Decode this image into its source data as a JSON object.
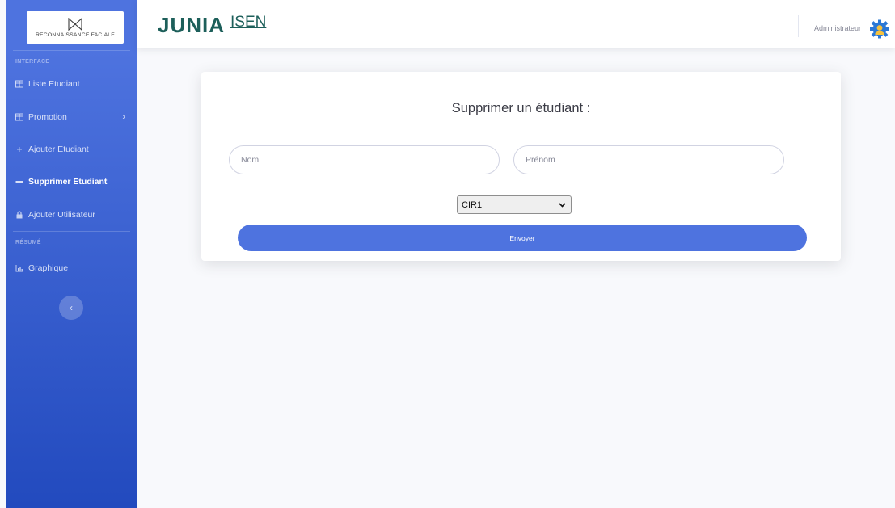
{
  "sidebar": {
    "logo_text": "RECONNAISSANCE FACIALE",
    "heading_interface": "INTERFACE",
    "heading_resume": "RÉSUMÉ",
    "items": [
      {
        "label": "Liste Etudiant",
        "icon": "table-icon"
      },
      {
        "label": "Promotion",
        "icon": "table-icon"
      },
      {
        "label": "Ajouter Etudiant",
        "icon": "plus-icon"
      },
      {
        "label": "Supprimer Etudiant",
        "icon": "minus-icon",
        "active": true
      },
      {
        "label": "Ajouter Utilisateur",
        "icon": "lock-icon"
      },
      {
        "label": "Graphique",
        "icon": "chart-icon"
      }
    ],
    "toggle_glyph": "‹"
  },
  "topbar": {
    "brand_main": "JUNIA",
    "brand_sub": "ISEN",
    "user_name": "Administrateur"
  },
  "form": {
    "title": "Supprimer un étudiant :",
    "nom_placeholder": "Nom",
    "prenom_placeholder": "Prénom",
    "promotion_selected": "CIR1",
    "submit_label": "Envoyer"
  },
  "colors": {
    "sidebar_top": "#4e73df",
    "sidebar_bottom": "#224abe",
    "primary": "#4e73df",
    "brand": "#1d5f5a",
    "background": "#f8f9fc"
  }
}
